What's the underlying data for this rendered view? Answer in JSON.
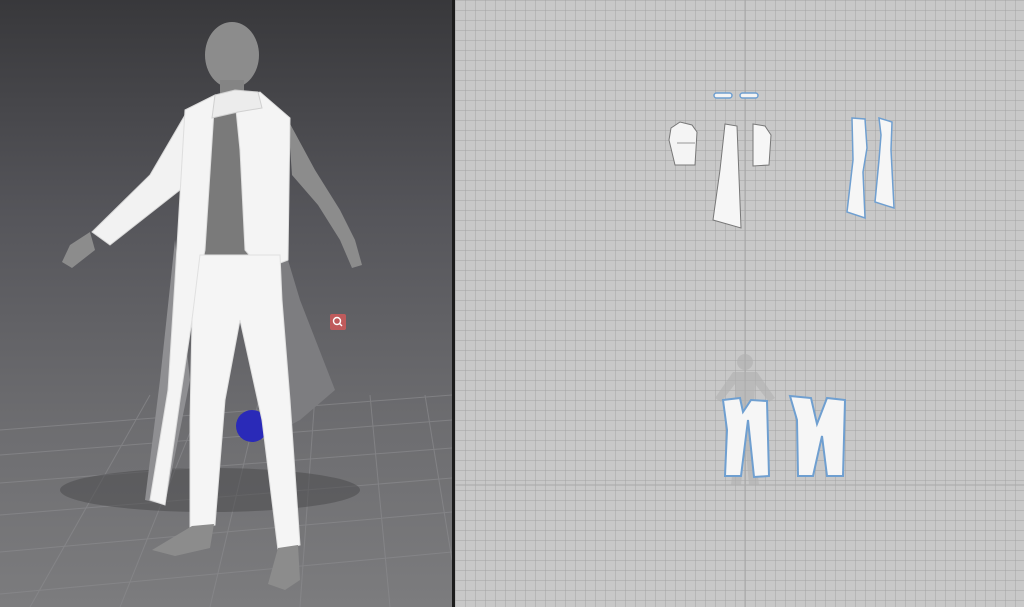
{
  "app": {
    "panes": [
      "3d-garment-view",
      "2d-pattern-view"
    ]
  },
  "colors": {
    "viewport_bg_top": "#38383b",
    "viewport_bg_bottom": "#7c7c7e",
    "pattern_bg": "#c8c8c8",
    "garment": "#f4f4f4",
    "avatar": "#8c8c8c",
    "pattern_outline_selected": "#6f9fd0",
    "pin_marker": "#d05a5a",
    "blue_object": "#2a2ab8"
  },
  "icons": {
    "pin_marker": "pin-marker-icon"
  }
}
